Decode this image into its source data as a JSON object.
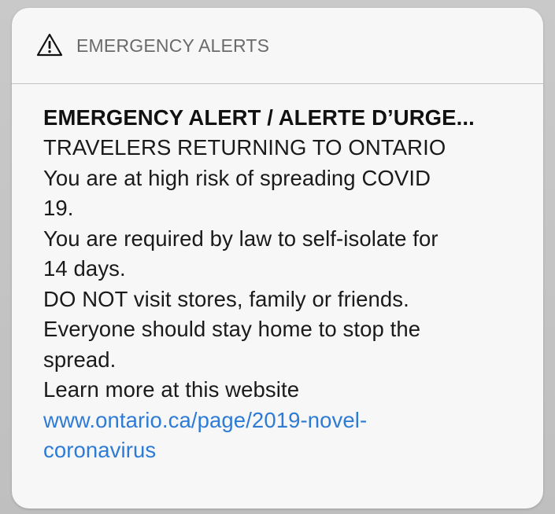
{
  "notification": {
    "app_name": "EMERGENCY ALERTS",
    "app_icon": "warning-triangle-icon",
    "title": "EMERGENCY ALERT / ALERTE D’URGE...",
    "lines": [
      "TRAVELERS RETURNING TO ONTARIO",
      "You are at high risk of spreading COVID",
      "19.",
      "You are required by law to self-isolate for",
      "14 days.",
      "DO NOT visit stores, family or friends.",
      "Everyone should stay home to stop the",
      "spread.",
      "Learn more at this website"
    ],
    "link_lines": [
      "www.ontario.ca/page/2019-novel-",
      "coronavirus"
    ],
    "link_color": "#2e7bd6"
  }
}
